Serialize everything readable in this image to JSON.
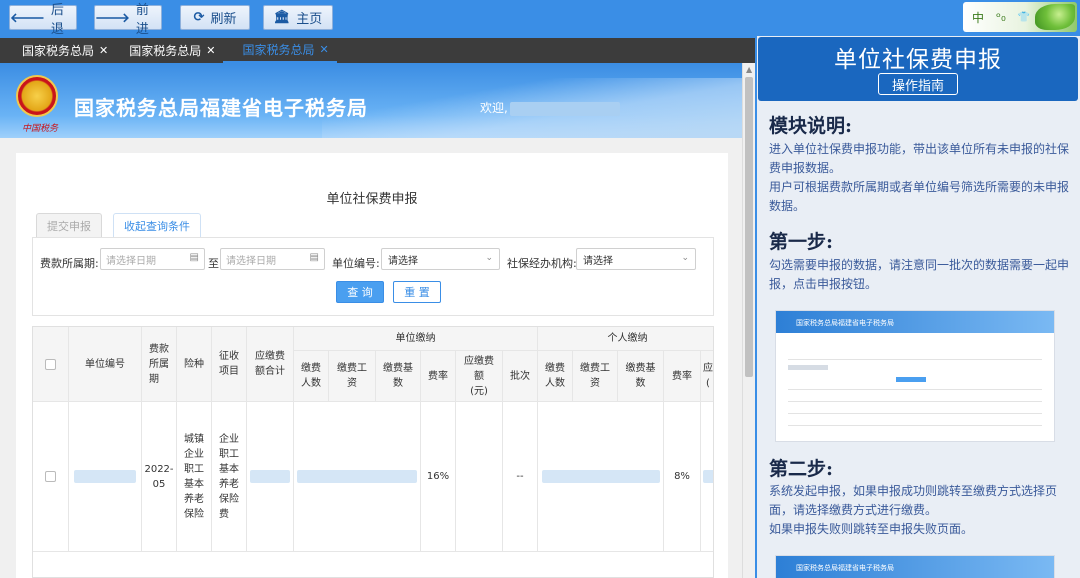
{
  "toolbar": {
    "back_label": "后退",
    "forward_label": "前进",
    "refresh_label": "刷新",
    "home_label": "主页",
    "lang_zh": "中",
    "lang_a": "ᵒ₀",
    "lang_b": "👕"
  },
  "tabs": [
    {
      "label": "国家税务总局",
      "close": "✕"
    },
    {
      "label": "国家税务总局",
      "close": "✕"
    },
    {
      "label": "国家税务总局",
      "close": "✕"
    }
  ],
  "banner": {
    "title": "国家税务总局福建省电子税务局",
    "emblem_caption": "中国税务",
    "welcome": "欢迎,"
  },
  "form": {
    "page_title": "单位社保费申报",
    "subtab_submit": "提交申报",
    "subtab_filter": "收起查询条件",
    "period_label": "费款所属期:",
    "date_start_placeholder": "请选择日期",
    "to_label": "至",
    "date_end_placeholder": "请选择日期",
    "unit_no_label": "单位编号:",
    "unit_no_value": "请选择",
    "agency_label": "社保经办机构:",
    "agency_value": "请选择",
    "query_button": "查 询",
    "reset_button": "重 置"
  },
  "table": {
    "group_unit": "单位缴纳",
    "group_person": "个人缴纳",
    "headers": {
      "unit_no": "单位编号",
      "period": "费款\n所属\n期",
      "insurance": "险种",
      "item": "征收\n项目",
      "total": "应缴费\n额合计",
      "u_count": "缴费\n人数",
      "u_wage": "缴费工\n资",
      "u_base": "缴费基\n数",
      "u_rate": "费率",
      "u_amount": "应缴费\n额\n(元)",
      "u_batch": "批次",
      "p_count": "缴费\n人数",
      "p_wage": "缴费工\n资",
      "p_base": "缴费基\n数",
      "p_rate": "费率",
      "p_amount": "应\n("
    },
    "row": {
      "period": "2022-\n05",
      "insurance": "城镇\n企业\n职工\n基本\n养老\n保险",
      "item": "企业\n职工\n基本\n养老\n保险\n费",
      "u_rate": "16%",
      "u_batch": "--",
      "p_rate": "8%"
    }
  },
  "guide": {
    "title": "单位社保费申报",
    "button": "操作指南",
    "module_heading": "模块说明:",
    "module_text_1": "进入单位社保费申报功能，带出该单位所有未申报的社保费申报数据。",
    "module_text_2": "用户可根据费款所属期或者单位编号筛选所需要的未申报数据。",
    "step1_heading": "第一步:",
    "step1_text": "勾选需要申报的数据，请注意同一批次的数据需要一起申报，点击申报按钮。",
    "step2_heading": "第二步:",
    "step2_text_1": "系统发起申报，如果申报成功则跳转至缴费方式选择页面，请选择缴费方式进行缴费。",
    "step2_text_2": "如果申报失败则跳转至申报失败页面。",
    "thumb_title": "国家税务总局福建省电子税务局"
  },
  "colors": {
    "toolbar_bg": "#3a8ee6",
    "guide_head": "#1a67bf",
    "tab_bar": "#3c3c3c",
    "accent": "#3a8ee6"
  }
}
